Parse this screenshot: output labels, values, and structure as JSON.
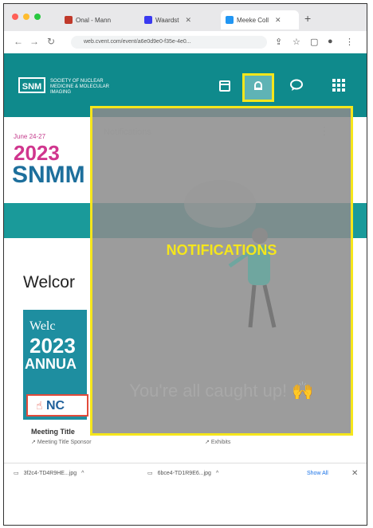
{
  "browser": {
    "tabs": [
      {
        "label": "Onal - Mann",
        "icon_color": "#c0392b"
      },
      {
        "label": "Waardst",
        "icon_color": "#3a3af0"
      },
      {
        "label": "Meeke Coll",
        "icon_color": "#2196f3"
      }
    ],
    "new_tab": "+",
    "url": "web.cvent.com/event/a6e0d9e0-f35e-4e0..."
  },
  "site": {
    "logo_mark": "SNM",
    "logo_text": "SOCIETY OF NUCLEAR MEDICINE & MOLECULAR IMAGING"
  },
  "banner": {
    "date": "June 24-27",
    "year": "2023",
    "name": "SNMM"
  },
  "main": {
    "welcome": "Welcor",
    "card": {
      "welcome": "Welc",
      "year": "2023",
      "annual": "ANNUA",
      "button": "NC",
      "title": "Meeting Title",
      "sponsor": "Meeting Title Sponsor",
      "exhibits": "Exhibits"
    }
  },
  "notifications": {
    "panel_title": "Notifications",
    "label": "NOTIFICATIONS",
    "empty_message": "You're all caught up! 🙌"
  },
  "downloads": {
    "items": [
      "3f2c4-TD4R9HE...jpg",
      "6bce4-TD1R9E6...jpg"
    ],
    "show_all": "Show All"
  },
  "colors": {
    "header_teal": "#0f8a8c",
    "highlight_yellow": "#f5e61b"
  }
}
